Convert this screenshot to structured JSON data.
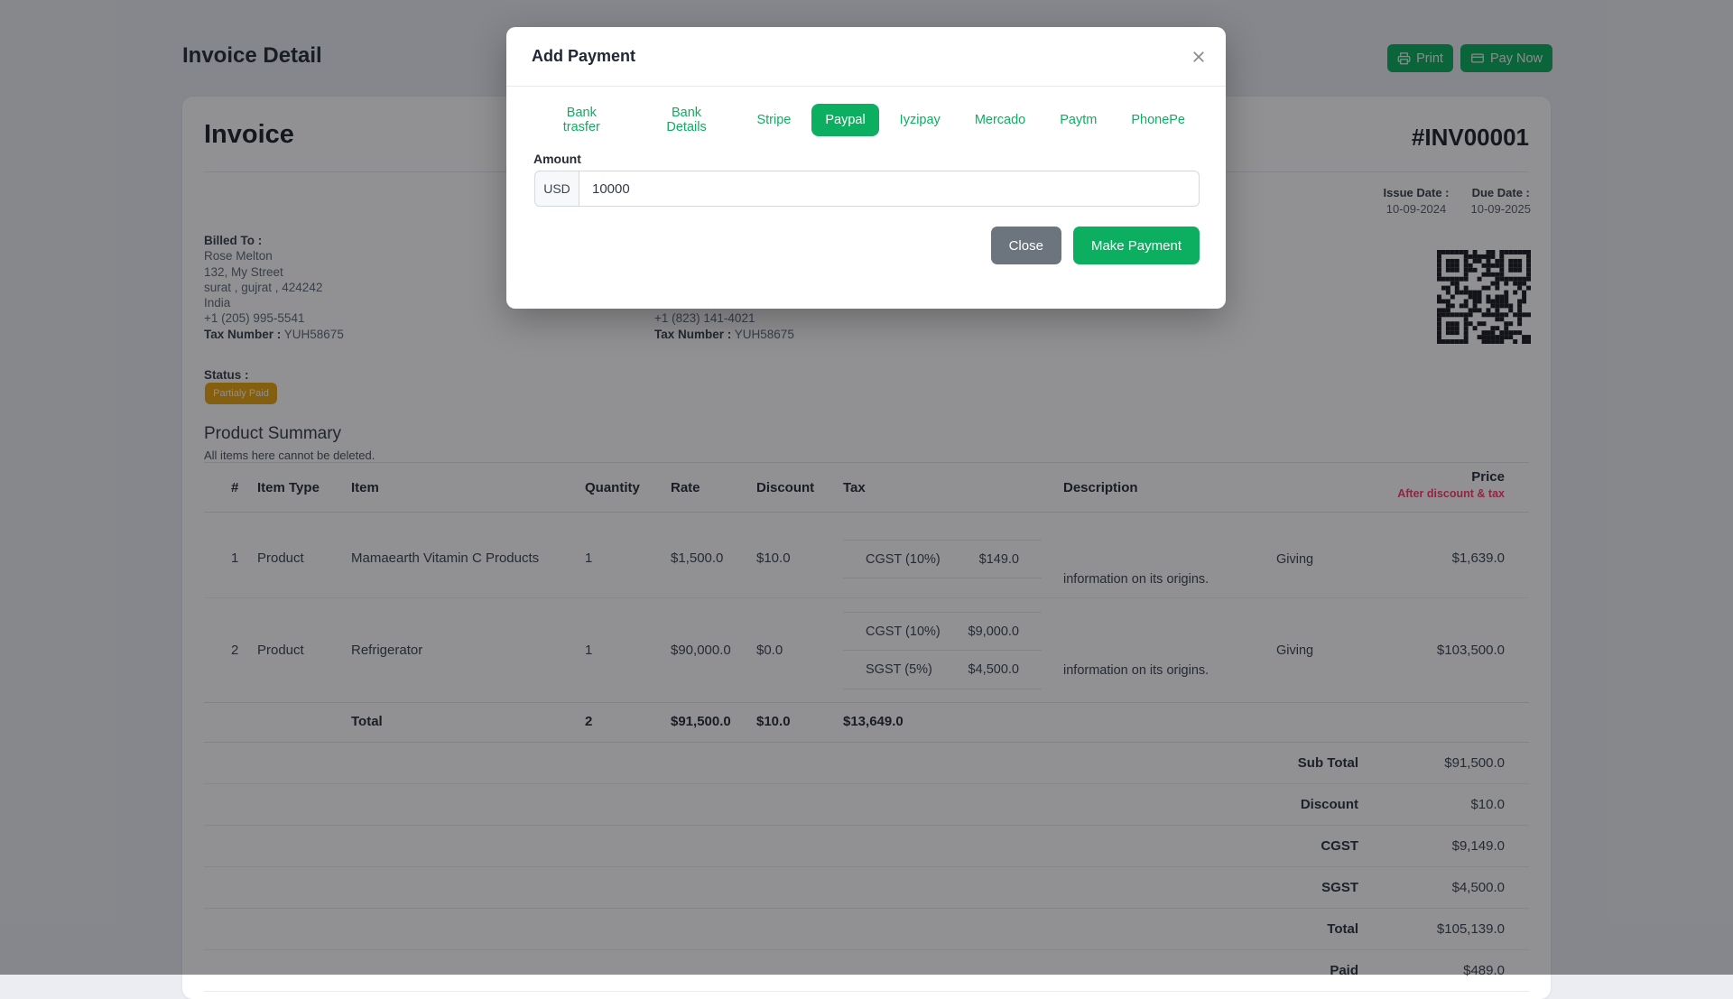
{
  "page": {
    "title": "Invoice Detail",
    "print_label": "Print",
    "pay_now_label": "Pay Now"
  },
  "colors": {
    "accent_green": "#0caf60",
    "danger_red": "#ff3a6e",
    "status_warning": "#e9a411"
  },
  "invoice": {
    "heading": "Invoice",
    "number": "#INV00001",
    "issue_date_label": "Issue Date :",
    "issue_date": "10-09-2024",
    "due_date_label": "Due Date :",
    "due_date": "10-09-2025",
    "billed_to": {
      "label": "Billed To :",
      "lines": [
        "Rose Melton",
        "132, My Street",
        "surat , gujrat , 424242",
        "India",
        "+1 (205) 995-5541"
      ],
      "tax_label": "Tax Number :",
      "tax_value": "YUH58675"
    },
    "shipped_to_visible": {
      "phone": "+1 (823) 141-4021",
      "tax_label": "Tax Number :",
      "tax_value": "YUH58675"
    },
    "status_label": "Status :",
    "status_value": "Partialy Paid",
    "qr_icon": "qr-code"
  },
  "product_summary": {
    "title": "Product Summary",
    "subtitle": "All items here cannot be deleted.",
    "columns": {
      "num": "#",
      "item_type": "Item Type",
      "item": "Item",
      "quantity": "Quantity",
      "rate": "Rate",
      "discount": "Discount",
      "tax": "Tax",
      "description": "Description",
      "price": "Price",
      "price_sub": "After discount & tax"
    },
    "rows": [
      {
        "num": "1",
        "item_type": "Product",
        "item": "Mamaearth Vitamin C Products",
        "quantity": "1",
        "rate": "$1,500.0",
        "discount": "$10.0",
        "taxes": [
          {
            "name": "CGST (10%)",
            "amount": "$149.0"
          }
        ],
        "description": "Giving information on its origins.",
        "price": "$1,639.0"
      },
      {
        "num": "2",
        "item_type": "Product",
        "item": "Refrigerator",
        "quantity": "1",
        "rate": "$90,000.0",
        "discount": "$0.0",
        "taxes": [
          {
            "name": "CGST (10%)",
            "amount": "$9,000.0"
          },
          {
            "name": "SGST (5%)",
            "amount": "$4,500.0"
          }
        ],
        "description": "Giving information on its origins.",
        "price": "$103,500.0"
      }
    ],
    "total_row": {
      "label": "Total",
      "quantity": "2",
      "rate": "$91,500.0",
      "discount": "$10.0",
      "tax": "$13,649.0"
    },
    "summary": [
      {
        "label": "Sub Total",
        "value": "$91,500.0"
      },
      {
        "label": "Discount",
        "value": "$10.0"
      },
      {
        "label": "CGST",
        "value": "$9,149.0"
      },
      {
        "label": "SGST",
        "value": "$4,500.0"
      },
      {
        "label": "Total",
        "value": "$105,139.0"
      },
      {
        "label": "Paid",
        "value": "$489.0"
      }
    ]
  },
  "modal": {
    "title": "Add Payment",
    "tabs": [
      "Bank trasfer",
      "Bank Details",
      "Stripe",
      "Paypal",
      "Iyzipay",
      "Mercado",
      "Paytm",
      "PhonePe"
    ],
    "selected_tab": "Paypal",
    "amount_label": "Amount",
    "currency": "USD",
    "amount_value": "10000",
    "close_label": "Close",
    "submit_label": "Make Payment"
  }
}
